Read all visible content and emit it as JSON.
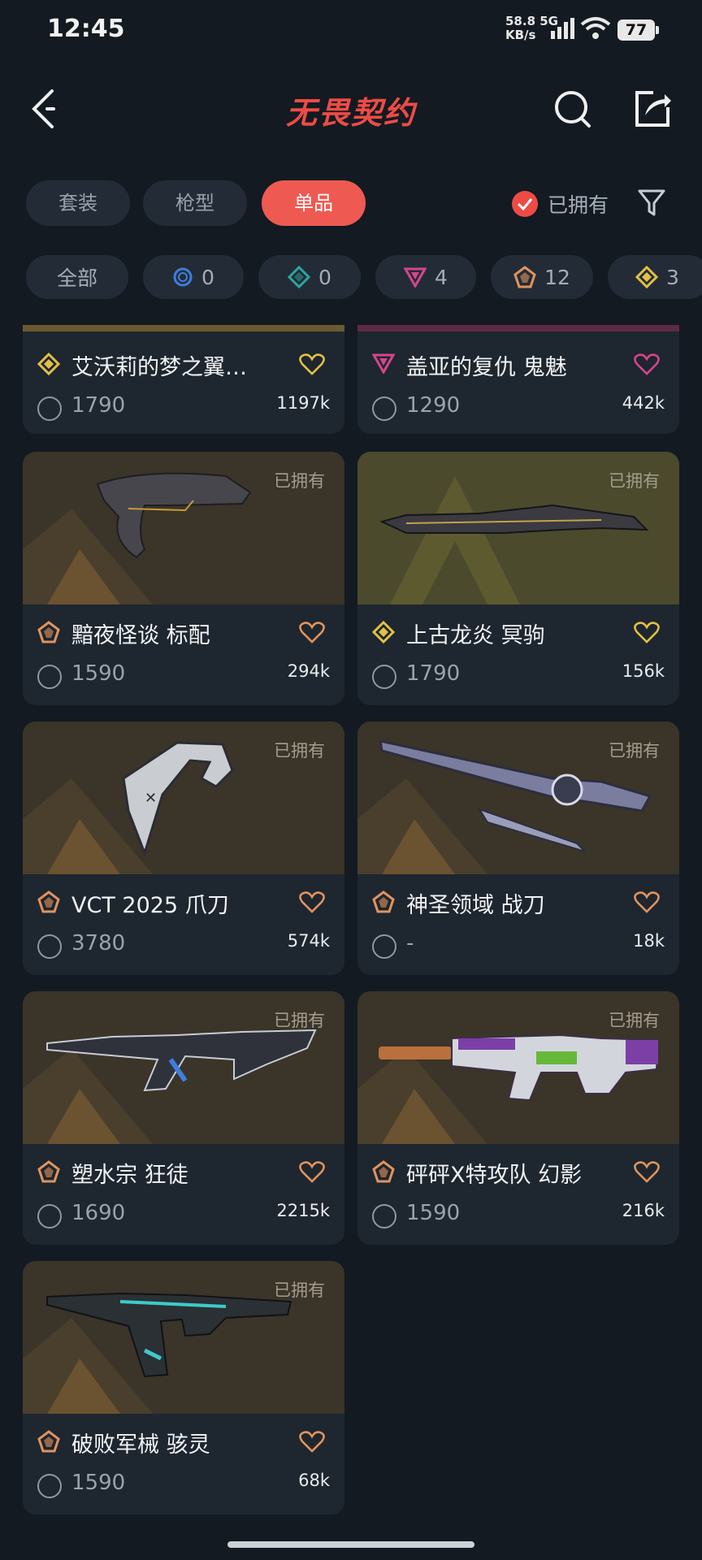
{
  "status_bar": {
    "time": "12:45",
    "net_speed": "58.8",
    "net_unit": "KB/s",
    "net_type": "5G",
    "battery": "77"
  },
  "header": {
    "title": "无畏契约"
  },
  "tabs": [
    {
      "label": "套装",
      "active": false
    },
    {
      "label": "枪型",
      "active": false
    },
    {
      "label": "单品",
      "active": true
    }
  ],
  "owned_filter": {
    "label": "已拥有",
    "checked": true
  },
  "tiers": [
    {
      "label": "全部"
    },
    {
      "icon": "select-tier-icon",
      "count": "0",
      "color": "#3f7de0"
    },
    {
      "icon": "deluxe-tier-icon",
      "count": "0",
      "color": "#2fa5a0"
    },
    {
      "icon": "premium-tier-icon",
      "count": "4",
      "color": "#d6458e"
    },
    {
      "icon": "exclusive-tier-icon",
      "count": "12",
      "color": "#e0935e"
    },
    {
      "icon": "ultra-tier-icon",
      "count": "3",
      "color": "#e2c046"
    }
  ],
  "cards": [
    {
      "name": "艾沃莉的梦之翼…",
      "price": "1790",
      "likes": "1197k",
      "tier": "ultra",
      "tier_color": "#e2c046",
      "heart_color": "#e2c046",
      "owned": "",
      "strip_color": "#6b5a2e"
    },
    {
      "name": "盖亚的复仇 鬼魅",
      "price": "1290",
      "likes": "442k",
      "tier": "premium",
      "tier_color": "#d6458e",
      "heart_color": "#d6458e",
      "owned": "",
      "strip_color": "#5e2a46"
    },
    {
      "name": "黯夜怪谈 标配",
      "price": "1590",
      "likes": "294k",
      "tier": "exclusive",
      "tier_color": "#e0935e",
      "heart_color": "#e0935e",
      "owned": "已拥有",
      "image": "revolver"
    },
    {
      "name": "上古龙炎 冥驹",
      "price": "1790",
      "likes": "156k",
      "tier": "ultra",
      "tier_color": "#e2c046",
      "heart_color": "#e2c046",
      "owned": "已拥有",
      "image": "rifle-dragon"
    },
    {
      "name": "VCT 2025 爪刀",
      "price": "3780",
      "likes": "574k",
      "tier": "exclusive",
      "tier_color": "#e0935e",
      "heart_color": "#e0935e",
      "owned": "已拥有",
      "image": "karambit"
    },
    {
      "name": "神圣领域 战刀",
      "price": "-",
      "likes": "18k",
      "tier": "exclusive",
      "tier_color": "#e0935e",
      "heart_color": "#e0935e",
      "owned": "已拥有",
      "image": "sword"
    },
    {
      "name": "塑水宗 狂徒",
      "price": "1690",
      "likes": "2215k",
      "tier": "exclusive",
      "tier_color": "#e0935e",
      "heart_color": "#e0935e",
      "owned": "已拥有",
      "image": "vandal"
    },
    {
      "name": "砰砰X特攻队 幻影",
      "price": "1590",
      "likes": "216k",
      "tier": "exclusive",
      "tier_color": "#e0935e",
      "heart_color": "#e0935e",
      "owned": "已拥有",
      "image": "phantom"
    },
    {
      "name": "破败军械 骇灵",
      "price": "1590",
      "likes": "68k",
      "tier": "exclusive",
      "tier_color": "#e0935e",
      "heart_color": "#e0935e",
      "owned": "已拥有",
      "image": "smg"
    }
  ]
}
